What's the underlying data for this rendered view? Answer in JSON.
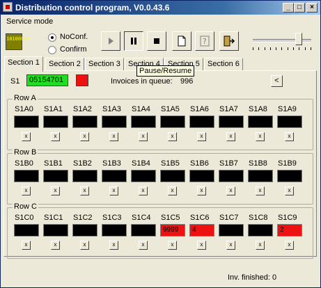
{
  "window": {
    "title": "Distribution control program, V0.0.43.6",
    "controls": [
      "_",
      "□",
      "×"
    ]
  },
  "menu": {
    "service_mode": "Service mode"
  },
  "toolbar": {
    "big_icon_text": "10100011",
    "radio_noconf": "NoConf.",
    "radio_confirm": "Confirm",
    "selected_mode": "NoConf.",
    "buttons": [
      "play",
      "pause",
      "stop",
      "new",
      "help",
      "exit"
    ],
    "slider_level": 0.78
  },
  "tooltip": "Pause/Resume",
  "tabs": [
    "Section 1",
    "Section 2",
    "Section 3",
    "Section 4",
    "Section 5",
    "Section 6"
  ],
  "active_tab": "Section 1",
  "section": {
    "s1_label": "S1",
    "s1_value": "05154701",
    "invoices_label": "Invoices in queue:",
    "invoices_value": "996",
    "collapse_label": "<"
  },
  "rows": [
    {
      "title": "Row A",
      "cells": [
        {
          "label": "S1A0",
          "value": "",
          "state": "black"
        },
        {
          "label": "S1A1",
          "value": "",
          "state": "black"
        },
        {
          "label": "S1A2",
          "value": "",
          "state": "black"
        },
        {
          "label": "S1A3",
          "value": "",
          "state": "black"
        },
        {
          "label": "S1A4",
          "value": "",
          "state": "black"
        },
        {
          "label": "S1A5",
          "value": "",
          "state": "black"
        },
        {
          "label": "S1A6",
          "value": "",
          "state": "black"
        },
        {
          "label": "S1A7",
          "value": "",
          "state": "black"
        },
        {
          "label": "S1A8",
          "value": "",
          "state": "black"
        },
        {
          "label": "S1A9",
          "value": "",
          "state": "black"
        }
      ]
    },
    {
      "title": "Row B",
      "cells": [
        {
          "label": "S1B0",
          "value": "",
          "state": "black"
        },
        {
          "label": "S1B1",
          "value": "",
          "state": "black"
        },
        {
          "label": "S1B2",
          "value": "",
          "state": "black"
        },
        {
          "label": "S1B3",
          "value": "",
          "state": "black"
        },
        {
          "label": "S1B4",
          "value": "",
          "state": "black"
        },
        {
          "label": "S1B5",
          "value": "",
          "state": "black"
        },
        {
          "label": "S1B6",
          "value": "",
          "state": "black"
        },
        {
          "label": "S1B7",
          "value": "",
          "state": "black"
        },
        {
          "label": "S1B8",
          "value": "",
          "state": "black"
        },
        {
          "label": "S1B9",
          "value": "",
          "state": "black"
        }
      ]
    },
    {
      "title": "Row C",
      "cells": [
        {
          "label": "S1C0",
          "value": "",
          "state": "black"
        },
        {
          "label": "S1C1",
          "value": "",
          "state": "black"
        },
        {
          "label": "S1C2",
          "value": "",
          "state": "black"
        },
        {
          "label": "S1C3",
          "value": "",
          "state": "black"
        },
        {
          "label": "S1C4",
          "value": "",
          "state": "black"
        },
        {
          "label": "S1C5",
          "value": "9999",
          "state": "red"
        },
        {
          "label": "S1C6",
          "value": "4",
          "state": "red"
        },
        {
          "label": "S1C7",
          "value": "",
          "state": "black"
        },
        {
          "label": "S1C8",
          "value": "",
          "state": "black"
        },
        {
          "label": "S1C9",
          "value": "2",
          "state": "red"
        }
      ]
    }
  ],
  "cell_button_label": "x",
  "status": {
    "finished": "Inv. finished: 0"
  },
  "colors": {
    "active": "#22dd22",
    "alert": "#ee1111",
    "idle": "#000000",
    "title_bar": "#0a246a"
  }
}
